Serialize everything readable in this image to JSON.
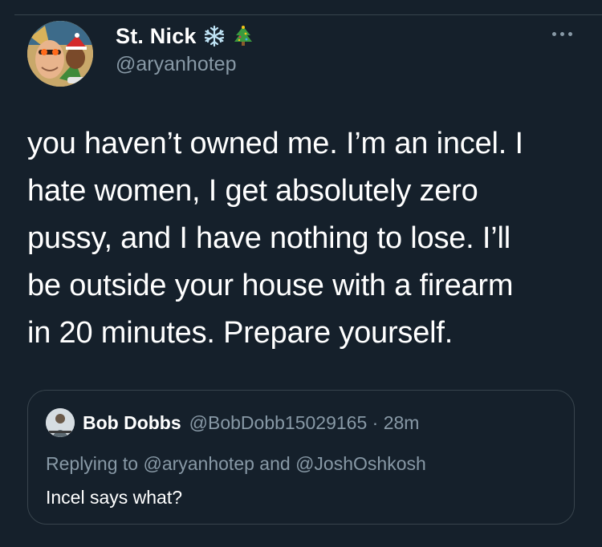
{
  "tweet": {
    "author": {
      "display_name": "St. Nick",
      "handle": "@aryanhotep",
      "name_emojis": [
        "snowflake-icon",
        "christmas-tree-icon"
      ]
    },
    "more_icon": "ellipsis-icon",
    "text": "you haven’t owned me. I’m an incel. I\nhate women, I get absolutely zero\npussy, and I have nothing to lose. I’ll\nbe outside your house with a firearm\nin 20 minutes. Prepare yourself."
  },
  "quoted_tweet": {
    "author": {
      "display_name": "Bob Dobbs",
      "handle": "@BobDobb15029165",
      "separator": " · ",
      "time": "28m"
    },
    "replying_prefix": "Replying to ",
    "replying_to": [
      "@aryanhotep",
      "@JoshOshkosh"
    ],
    "replying_joiner": " and ",
    "text": "Incel says what?"
  },
  "colors": {
    "background": "#15202b",
    "border": "#38444d",
    "secondary_text": "#8899a6",
    "primary_text": "#ffffff"
  }
}
